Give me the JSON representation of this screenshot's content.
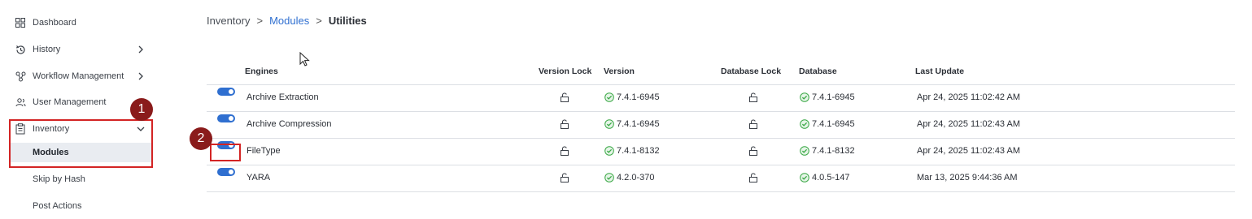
{
  "sidebar": {
    "items": [
      {
        "label": "Dashboard",
        "icon": "grid-icon"
      },
      {
        "label": "History",
        "icon": "history-icon"
      },
      {
        "label": "Workflow Management",
        "icon": "workflow-icon"
      },
      {
        "label": "User Management",
        "icon": "users-icon"
      },
      {
        "label": "Inventory",
        "icon": "clipboard-icon"
      }
    ],
    "sub_items": [
      {
        "label": "Modules"
      },
      {
        "label": "Skip by Hash"
      },
      {
        "label": "Post Actions"
      }
    ]
  },
  "markers": {
    "one": "1",
    "two": "2"
  },
  "breadcrumb": {
    "root": "Inventory",
    "link": "Modules",
    "current": "Utilities",
    "separator": ">"
  },
  "table": {
    "headers": {
      "engines": "Engines",
      "version_lock": "Version Lock",
      "version": "Version",
      "database_lock": "Database Lock",
      "database": "Database",
      "last_update": "Last Update"
    },
    "rows": [
      {
        "enabled": true,
        "engine": "Archive Extraction",
        "version": "7.4.1-6945",
        "database": "7.4.1-6945",
        "last_update": "Apr 24, 2025 11:02:42 AM"
      },
      {
        "enabled": true,
        "engine": "Archive Compression",
        "version": "7.4.1-6945",
        "database": "7.4.1-6945",
        "last_update": "Apr 24, 2025 11:02:43 AM"
      },
      {
        "enabled": true,
        "engine": "FileType",
        "version": "7.4.1-8132",
        "database": "7.4.1-8132",
        "last_update": "Apr 24, 2025 11:02:43 AM"
      },
      {
        "enabled": true,
        "engine": "YARA",
        "version": "4.2.0-370",
        "database": "4.0.5-147",
        "last_update": "Mar 13, 2025 9:44:36 AM"
      }
    ]
  },
  "colors": {
    "accent": "#2f6fd0",
    "highlight": "#d32424",
    "marker": "#8a1b1b",
    "ok": "#3aa845"
  }
}
